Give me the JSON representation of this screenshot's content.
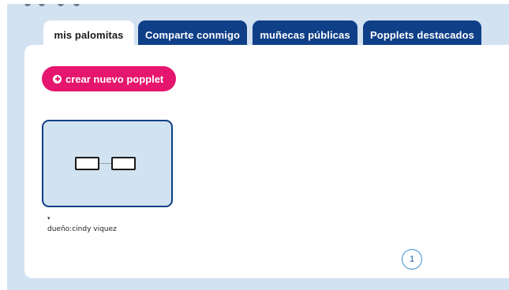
{
  "tabs": [
    {
      "label": "mis palomitas",
      "active": true
    },
    {
      "label": "Comparte conmigo",
      "active": false
    },
    {
      "label": "muñecas públicas",
      "active": false
    },
    {
      "label": "Popplets destacados",
      "active": false
    }
  ],
  "create_button": {
    "label": "crear nuevo popplet",
    "icon": "plus-circle-icon"
  },
  "popplets": [
    {
      "caret": "▾",
      "owner": "dueño:cindy viquez"
    }
  ],
  "pagination": {
    "current_page": "1"
  },
  "colors": {
    "background": "#d2e2f1",
    "tab_active": "#ffffff",
    "tab_inactive": "#0f3f87",
    "accent": "#e6156d",
    "card_border": "#0f3f87"
  }
}
